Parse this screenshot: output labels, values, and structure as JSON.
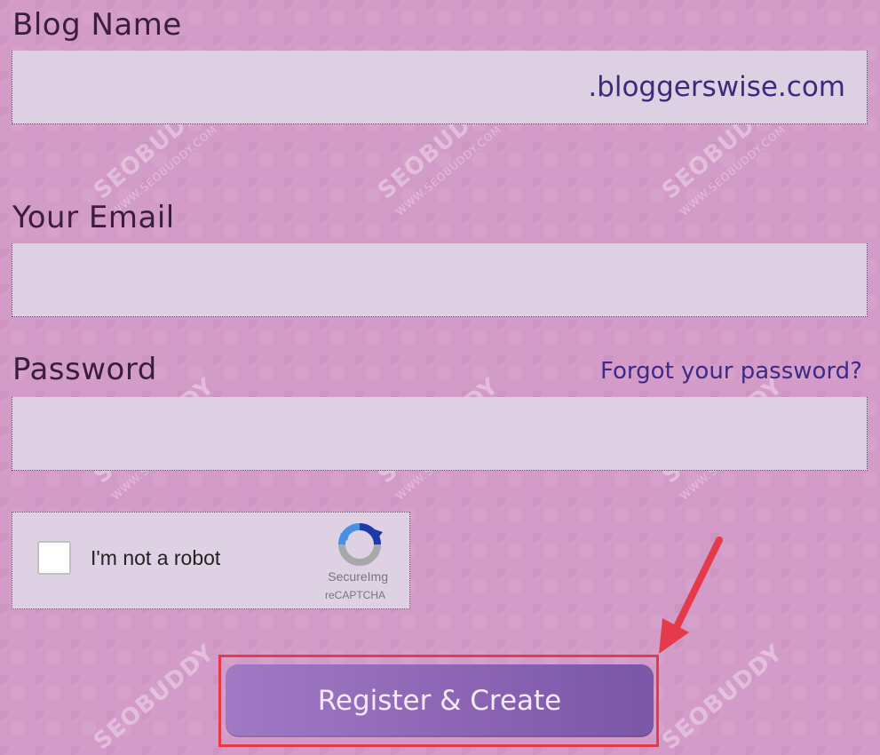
{
  "form": {
    "blog_name_label": "Blog Name",
    "blog_name_value": "",
    "blog_suffix": ".bloggerswise.com",
    "email_label": "Your Email",
    "email_value": "",
    "password_label": "Password",
    "password_value": "",
    "forgot_password": "Forgot your password?"
  },
  "captcha": {
    "label": "I'm not a robot",
    "brand": "SecureImg",
    "sub": "reCAPTCHA",
    "checked": false
  },
  "actions": {
    "register_label": "Register & Create"
  },
  "watermark": {
    "brand": "SEOBUDDY",
    "url": "WWW.SEOBUDDY.COM"
  },
  "colors": {
    "background": "#d39bc7",
    "field_bg": "#ddd0e2",
    "button_start": "#a07ac5",
    "button_end": "#7b57a7",
    "highlight": "#e53a4a",
    "link": "#3f2a85"
  },
  "icons": {
    "captcha_logo": "recaptcha-logo-icon",
    "annotation_arrow": "arrow-icon"
  }
}
